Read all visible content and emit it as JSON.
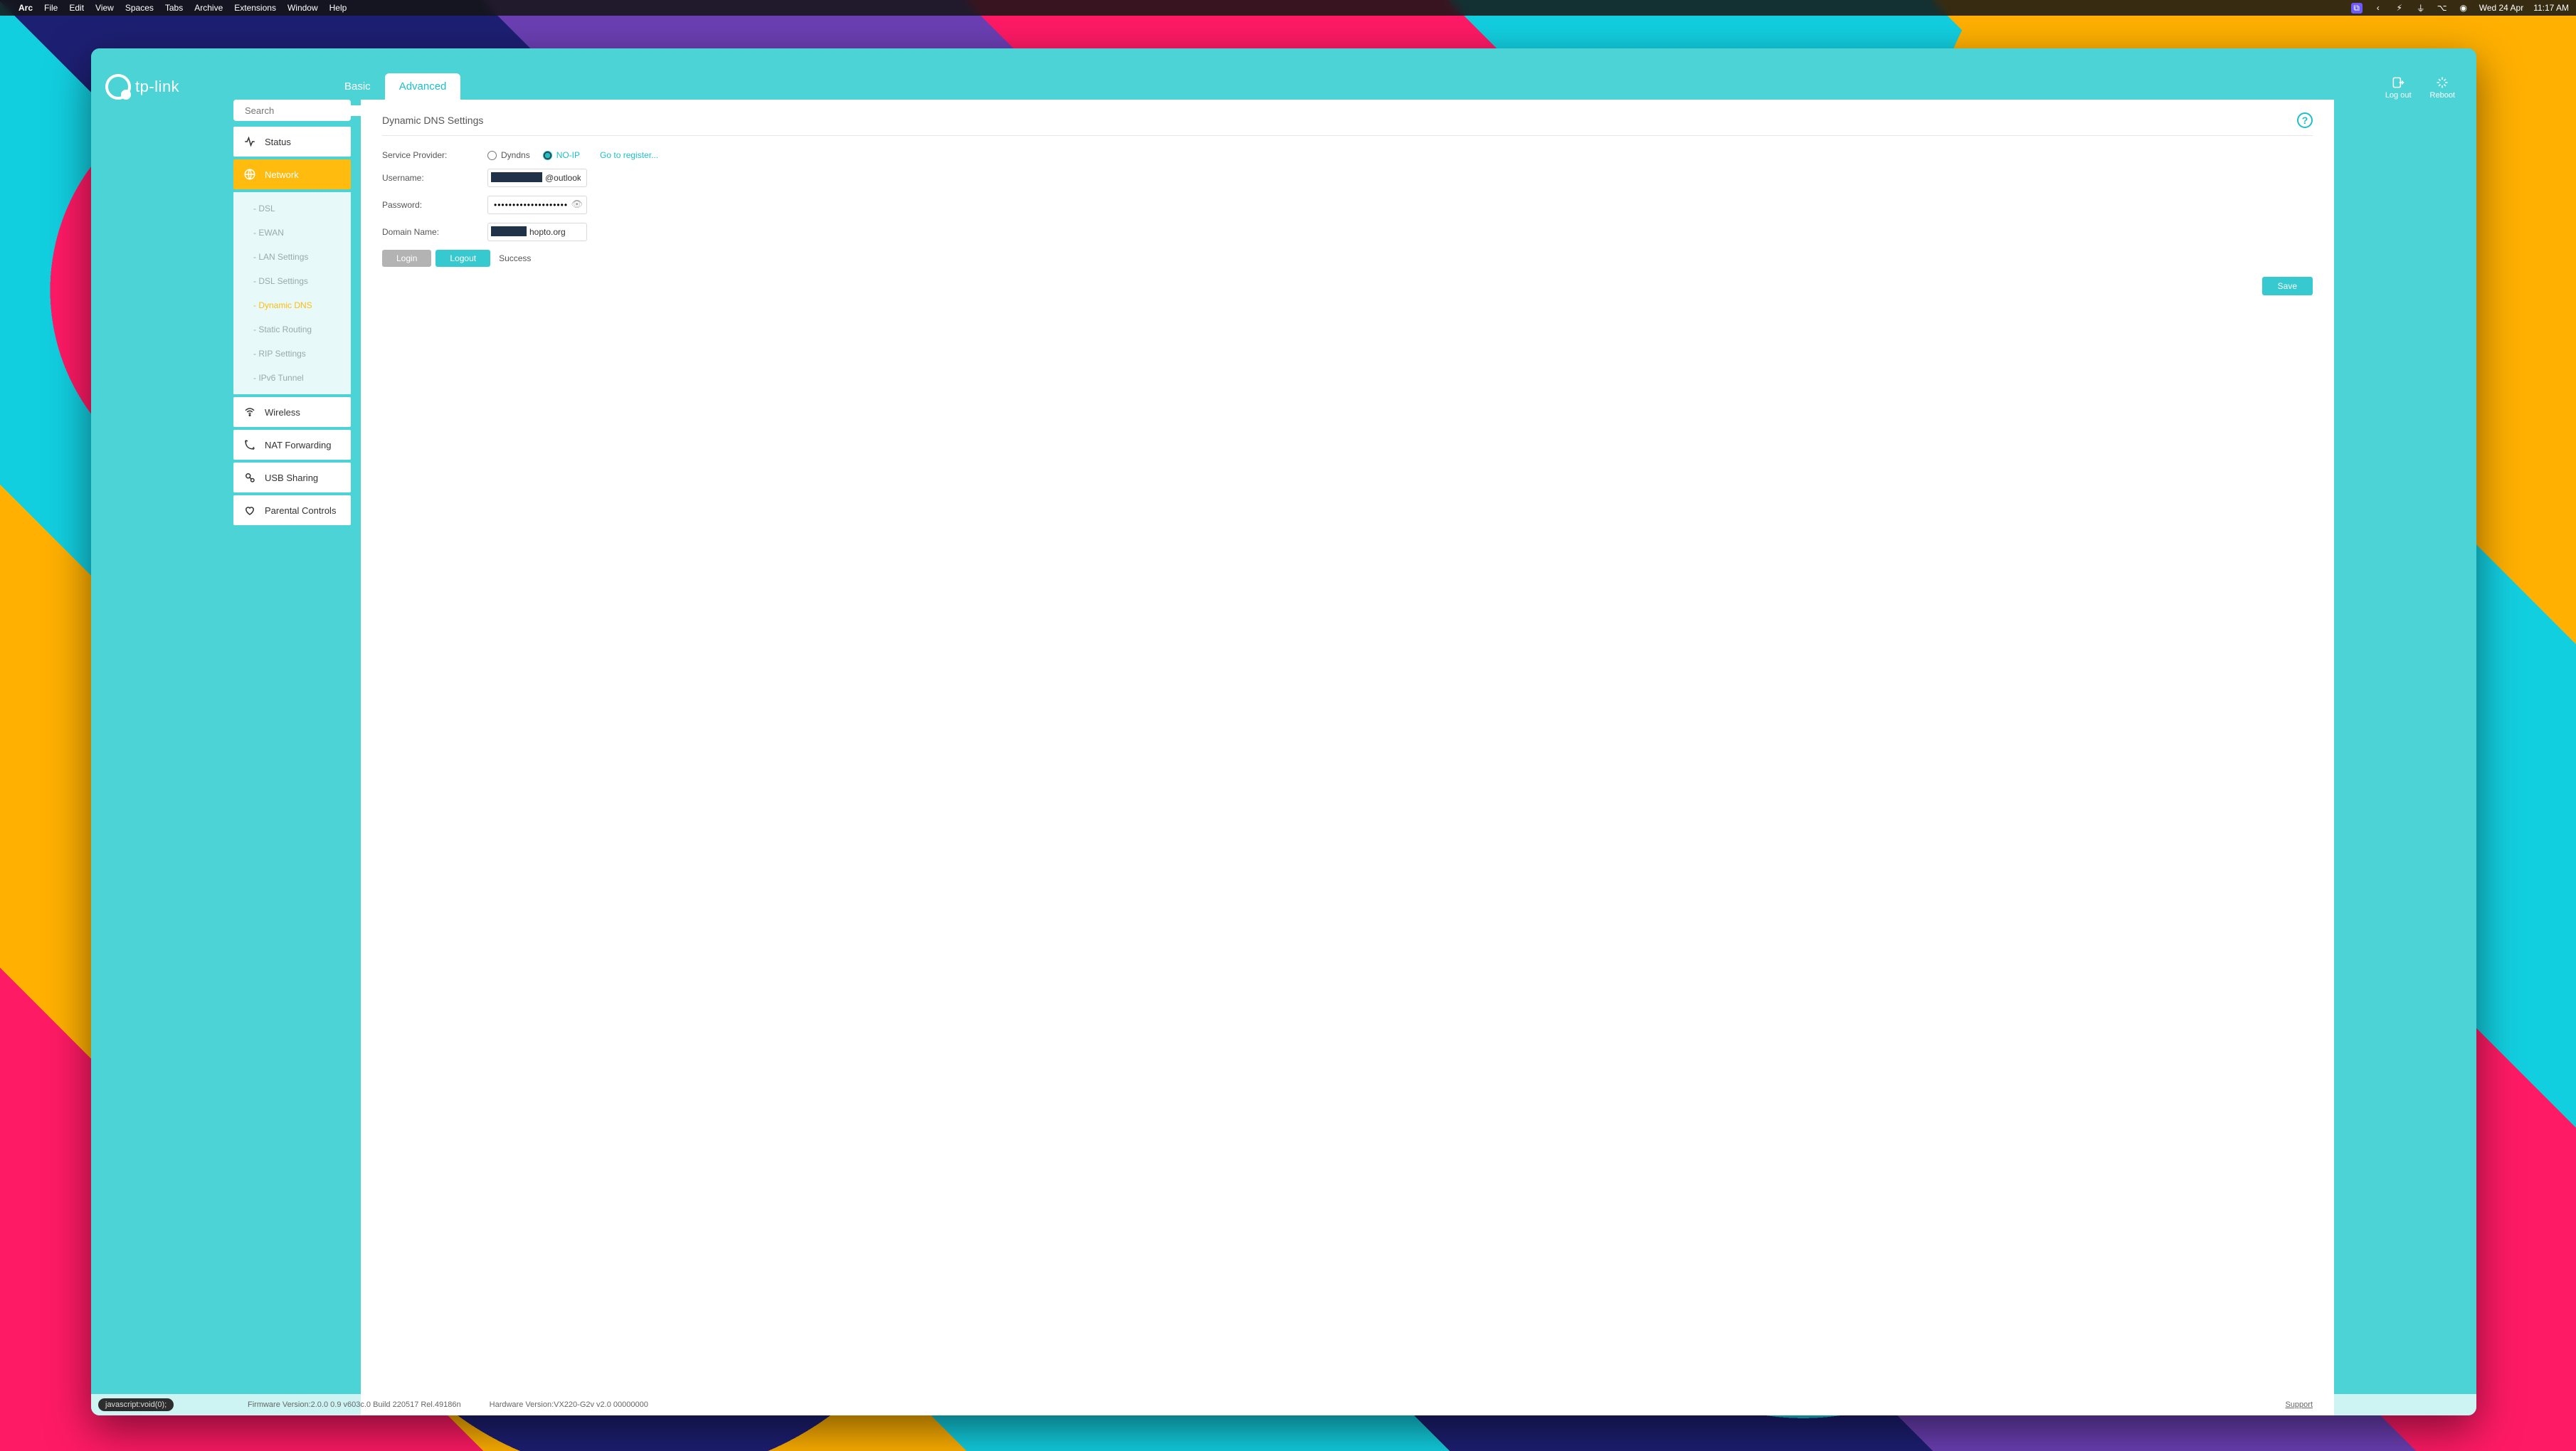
{
  "mac_menu": {
    "apple": "",
    "app": "Arc",
    "items": [
      "File",
      "Edit",
      "View",
      "Spaces",
      "Tabs",
      "Archive",
      "Extensions",
      "Window",
      "Help"
    ],
    "date": "Wed 24 Apr",
    "time": "11:17 AM"
  },
  "header": {
    "brand": "tp-link",
    "tabs": {
      "basic": "Basic",
      "advanced": "Advanced"
    },
    "logout": "Log out",
    "reboot": "Reboot"
  },
  "search": {
    "placeholder": "Search"
  },
  "nav": {
    "items": [
      {
        "id": "status",
        "label": "Status"
      },
      {
        "id": "network",
        "label": "Network",
        "active": true,
        "sub": [
          {
            "id": "dsl",
            "label": "- DSL"
          },
          {
            "id": "ewan",
            "label": "- EWAN"
          },
          {
            "id": "lan",
            "label": "- LAN Settings"
          },
          {
            "id": "dsls",
            "label": "- DSL Settings"
          },
          {
            "id": "ddns",
            "label": "- Dynamic DNS",
            "active": true
          },
          {
            "id": "sroute",
            "label": "- Static Routing"
          },
          {
            "id": "rip",
            "label": "- RIP Settings"
          },
          {
            "id": "ipv6",
            "label": "- IPv6 Tunnel"
          }
        ]
      },
      {
        "id": "wireless",
        "label": "Wireless"
      },
      {
        "id": "nat",
        "label": "NAT Forwarding"
      },
      {
        "id": "usb",
        "label": "USB Sharing"
      },
      {
        "id": "parental",
        "label": "Parental Controls"
      }
    ]
  },
  "panel": {
    "title": "Dynamic DNS Settings",
    "service_provider_label": "Service Provider:",
    "provider_dyndns": "Dyndns",
    "provider_noip": "NO-IP",
    "register_link": "Go to register...",
    "username_label": "Username:",
    "username_suffix": "@outlook.",
    "password_label": "Password:",
    "password_mask": "••••••••••••••••••••",
    "domain_label": "Domain Name:",
    "domain_suffix": "hopto.org",
    "login_btn": "Login",
    "logout_btn": "Logout",
    "status": "Success",
    "save_btn": "Save"
  },
  "footer": {
    "fw": "Firmware Version:2.0.0 0.9 v603c.0 Build 220517 Rel.49186n",
    "hw": "Hardware Version:VX220-G2v v2.0 00000000",
    "support": "Support"
  },
  "status_pill": "javascript:void(0);"
}
